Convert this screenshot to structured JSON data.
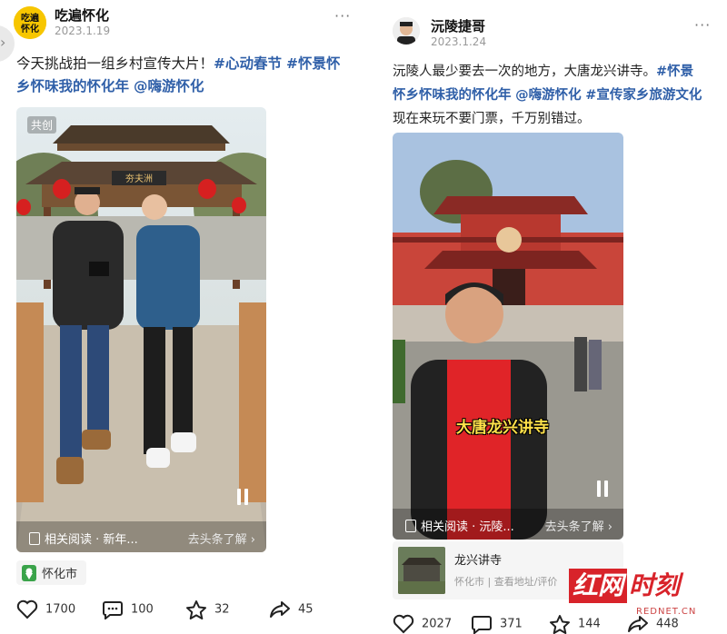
{
  "left": {
    "author": "吃遍怀化",
    "avatar_text": "吃遍\n怀化",
    "date": "2023.1.19",
    "more": "···",
    "text_line1": "今天挑战拍一组乡村宣传大片！",
    "tag1": "#心动春节",
    "tag2": "#怀景怀",
    "tag2b": "乡怀味我的怀化年",
    "mention": "@嗨游怀化",
    "badge": "共创",
    "sign_text": "夯夫洲",
    "related_left": "相关阅读 · 新年...",
    "related_right": "去头条了解 ›",
    "location": "怀化市",
    "likes": "1700",
    "comments": "100",
    "stars": "32",
    "shares": "45"
  },
  "right": {
    "author": "沅陵捷哥",
    "date": "2023.1.24",
    "more": "···",
    "text_line1": "沅陵人最少要去一次的地方，大唐龙兴讲寺。",
    "tag1": "#怀景",
    "tag1b": "怀乡怀味我的怀化年",
    "mention": "@嗨游怀化",
    "tag2": "#宣传家乡旅游文化",
    "text_line3": "现在来玩不要门票，千万别错过。",
    "overlay_caption": "大唐龙兴讲寺",
    "related_left": "相关阅读 · 沅陵...",
    "related_right": "去头条了解 ›",
    "card_title": "龙兴讲寺",
    "card_sub": "怀化市 | 查看地址/评价",
    "likes": "2027",
    "comments": "371",
    "stars": "144",
    "shares": "448"
  },
  "watermark": {
    "box": "红网",
    "text": "时刻",
    "sub": "REDNET.CN"
  },
  "colors": {
    "tag": "#2f5fa8",
    "brand_red": "#d8232a"
  },
  "icons": [
    "heart-icon",
    "comment-icon",
    "star-icon",
    "share-icon",
    "location-pin-icon",
    "pause-icon",
    "document-icon"
  ]
}
